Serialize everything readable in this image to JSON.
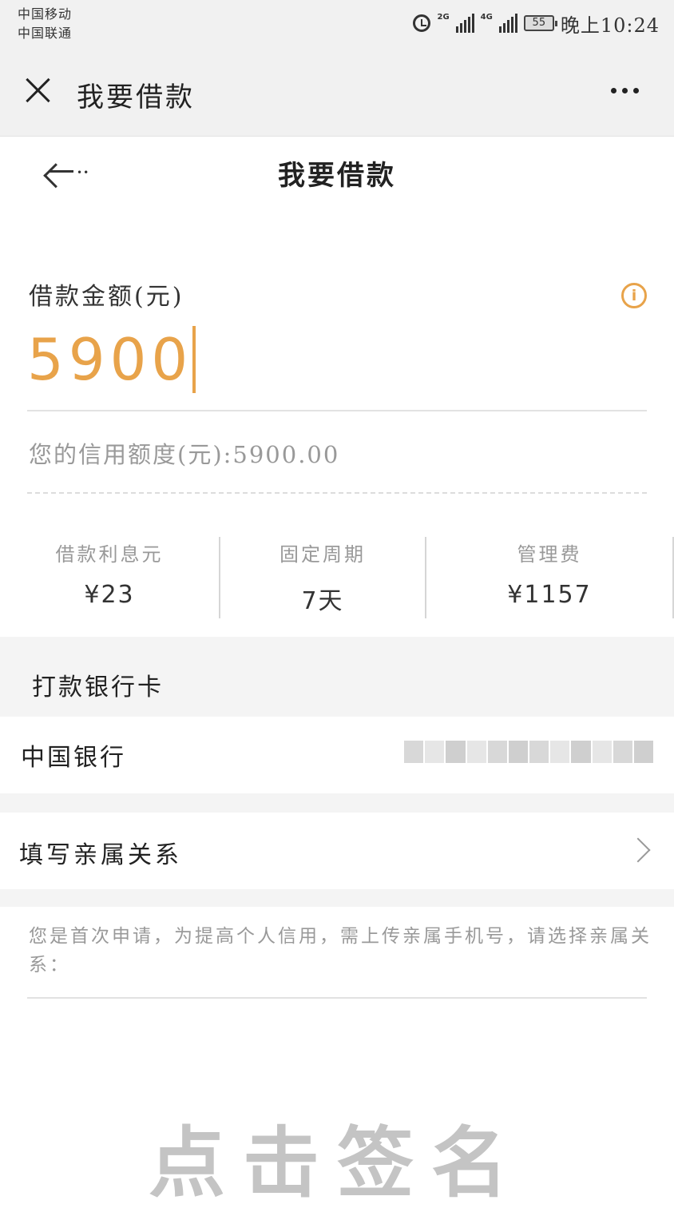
{
  "status_bar": {
    "carrier_1": "中国移动",
    "carrier_2": "中国联通",
    "net_1": "2G",
    "net_2": "4G",
    "battery": "55",
    "time": "晚上10:24"
  },
  "app_bar": {
    "title": "我要借款"
  },
  "page": {
    "title": "我要借款"
  },
  "amount": {
    "label": "借款金额(元)",
    "value": "5900"
  },
  "credit": {
    "text": "您的信用额度(元):5900.00"
  },
  "stats": [
    {
      "label": "借款利息元",
      "value": "¥23"
    },
    {
      "label": "固定周期",
      "value": "7天"
    },
    {
      "label": "管理费",
      "value": "¥1157"
    }
  ],
  "bank_section": {
    "title": "打款银行卡",
    "bank_name": "中国银行"
  },
  "relative": {
    "label": "填写亲属关系"
  },
  "notice": "您是首次申请，为提高个人信用，需上传亲属手机号，请选择亲属关系：",
  "sign": {
    "label": "点击签名"
  },
  "colors": {
    "accent": "#e8a34a",
    "section_bg": "#f4f4f4",
    "muted_text": "#999999"
  }
}
